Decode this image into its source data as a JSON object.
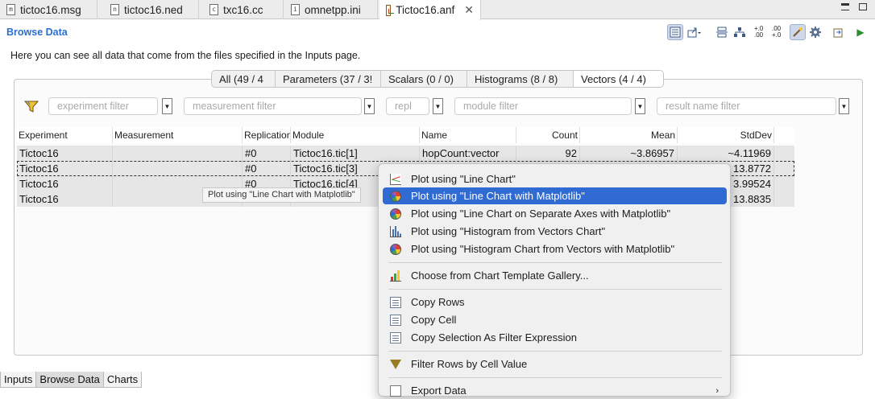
{
  "editor_tabs": [
    {
      "label": "tictoc16.msg",
      "icon": "msg-file-icon",
      "glyph": "m"
    },
    {
      "label": "tictoc16.ned",
      "icon": "ned-file-icon",
      "glyph": "n"
    },
    {
      "label": "txc16.cc",
      "icon": "cpp-file-icon",
      "glyph": "c"
    },
    {
      "label": "omnetpp.ini",
      "icon": "ini-file-icon",
      "glyph": "i"
    },
    {
      "label": "Tictoc16.anf",
      "icon": "anf-file-icon",
      "glyph": "",
      "active": true
    }
  ],
  "close_glyph": "✕",
  "header": {
    "title": "Browse Data",
    "intro": "Here you can see all data that come from the files specified in the Inputs page."
  },
  "category_tabs": [
    {
      "label": "All (49 / 4"
    },
    {
      "label": "Parameters (37 / 3!"
    },
    {
      "label": "Scalars (0 / 0)"
    },
    {
      "label": "Histograms (8 / 8)"
    },
    {
      "label": "Vectors (4 / 4)",
      "active": true
    }
  ],
  "filters": {
    "experiment": "experiment filter",
    "measurement": "measurement filter",
    "replication": "repl",
    "module": "module filter",
    "result_name": "result name filter",
    "dropdown_glyph": "▼"
  },
  "table": {
    "columns": [
      "Experiment",
      "Measurement",
      "Replication",
      "Module",
      "Name",
      "Count",
      "Mean",
      "StdDev"
    ],
    "rows": [
      [
        "Tictoc16",
        "",
        "#0",
        "Tictoc16.tic[1]",
        "hopCount:vector",
        "92",
        "~3.86957",
        "~4.11969"
      ],
      [
        "Tictoc16",
        "",
        "#0",
        "Tictoc16.tic[3]",
        "",
        "",
        "",
        "13.8772"
      ],
      [
        "Tictoc16",
        "",
        "#0",
        "Tictoc16.tic[4]",
        "",
        "",
        "",
        "3.99524"
      ],
      [
        "Tictoc16",
        "",
        "",
        "",
        "",
        "",
        "",
        "13.8835"
      ]
    ]
  },
  "tooltip": "Plot using \"Line Chart with Matplotlib\"",
  "context_menu": {
    "items": [
      {
        "label": "Plot using \"Line Chart\"",
        "icon": "line-chart-icon"
      },
      {
        "label": "Plot using \"Line Chart with Matplotlib\"",
        "icon": "matplotlib-icon",
        "highlighted": true
      },
      {
        "label": "Plot using \"Line Chart on Separate Axes with Matplotlib\"",
        "icon": "matplotlib-icon"
      },
      {
        "label": "Plot using \"Histogram from Vectors Chart\"",
        "icon": "histogram-icon"
      },
      {
        "label": "Plot using \"Histogram Chart from Vectors with Matplotlib\"",
        "icon": "matplotlib-icon"
      },
      {
        "label": "Choose from Chart Template Gallery...",
        "icon": "gallery-icon"
      },
      {
        "label": "Copy Rows",
        "icon": "copy-icon"
      },
      {
        "label": "Copy Cell",
        "icon": "copy-icon"
      },
      {
        "label": "Copy Selection As Filter Expression",
        "icon": "copy-icon"
      },
      {
        "label": "Filter Rows by Cell Value",
        "icon": "filter-icon"
      },
      {
        "label": "Export Data",
        "icon": "export-icon",
        "submenu": true
      }
    ],
    "submenu_glyph": "›"
  },
  "bottom_tabs": [
    {
      "label": "Inputs"
    },
    {
      "label": "Browse Data",
      "active": true
    },
    {
      "label": "Charts"
    }
  ],
  "toolbar_icons": [
    "show-table-icon",
    "export-menu-icon",
    "expand-all-icon",
    "tree-layout-icon",
    "increase-precision-icon",
    "decrease-precision-icon",
    "wand-icon",
    "settings-gear-icon",
    "refresh-icon",
    "run-icon"
  ],
  "toolbar_glyphs": {
    "increase_precision": "+.0 .00",
    "decrease_precision": ".00 +.0",
    "run": "▶"
  },
  "colors": {
    "title_blue": "#2a6fcf",
    "menu_highlight": "#2f6bd3",
    "row_background": "#e6e6e6"
  }
}
